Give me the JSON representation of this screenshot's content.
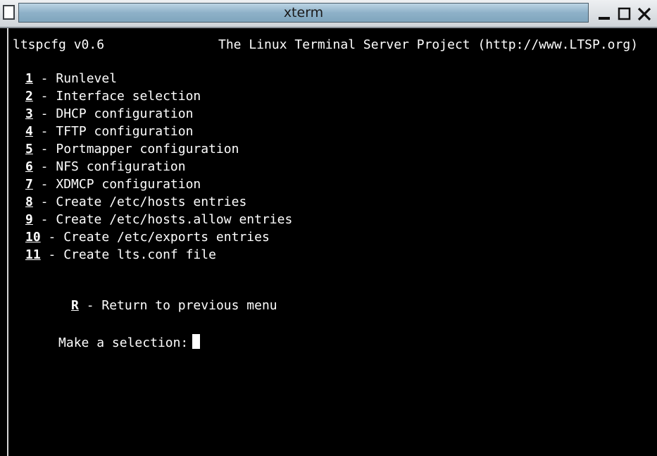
{
  "window": {
    "title": "xterm",
    "buttons": {
      "minimize": "minimize-icon",
      "maximize": "maximize-icon",
      "close": "close-icon"
    }
  },
  "terminal": {
    "header_left": "ltspcfg v0.6",
    "header_right": "The Linux Terminal Server Project (http://www.LTSP.org)",
    "options": [
      {
        "key": "1",
        "text": " - Runlevel"
      },
      {
        "key": "2",
        "text": " - Interface selection"
      },
      {
        "key": "3",
        "text": " - DHCP configuration"
      },
      {
        "key": "4",
        "text": " - TFTP configuration"
      },
      {
        "key": "5",
        "text": " - Portmapper configuration"
      },
      {
        "key": "6",
        "text": " - NFS configuration"
      },
      {
        "key": "7",
        "text": " - XDMCP configuration"
      },
      {
        "key": "8",
        "text": " - Create /etc/hosts entries"
      },
      {
        "key": "9",
        "text": " - Create /etc/hosts.allow entries"
      },
      {
        "key": "10",
        "text": " - Create /etc/exports entries"
      },
      {
        "key": "11",
        "text": " - Create lts.conf file"
      }
    ],
    "return_option": {
      "key": "R",
      "text": " - Return to previous menu"
    },
    "prompt": "Make a selection:"
  },
  "colors": {
    "terminal_bg": "#000000",
    "terminal_fg": "#ffffff",
    "titlebar_active": "#8eb1c8"
  }
}
